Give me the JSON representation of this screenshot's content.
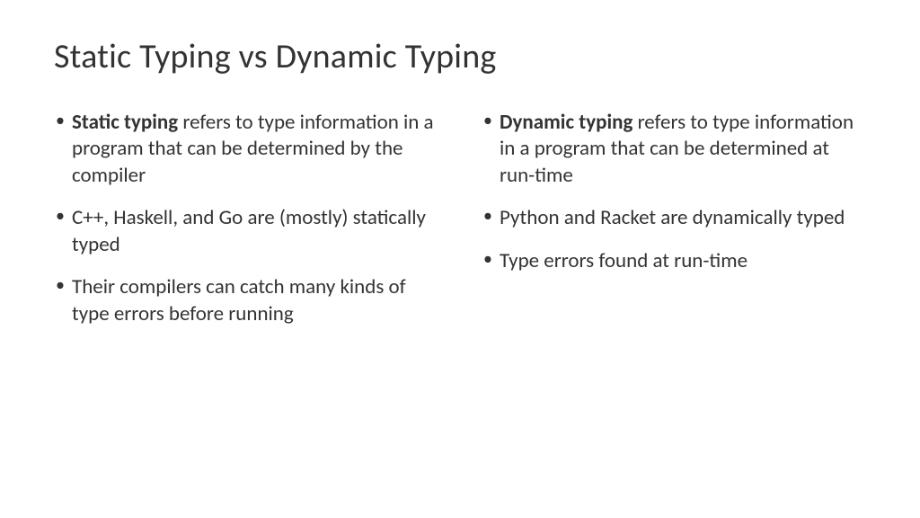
{
  "title": "Static Typing vs Dynamic Typing",
  "left": {
    "items": [
      {
        "bold": "Static typing",
        "rest": " refers to type information in a program that can be determined by the compiler"
      },
      {
        "bold": "",
        "rest": "C++, Haskell, and Go are (mostly) statically typed"
      },
      {
        "bold": "",
        "rest": "Their compilers can catch many kinds of type errors before running"
      }
    ]
  },
  "right": {
    "items": [
      {
        "bold": "Dynamic typing",
        "rest": " refers to type information in a program that can be determined at run-time"
      },
      {
        "bold": "",
        "rest": "Python and Racket are dynamically typed"
      },
      {
        "bold": "",
        "rest": "Type errors found at run-time"
      }
    ]
  }
}
